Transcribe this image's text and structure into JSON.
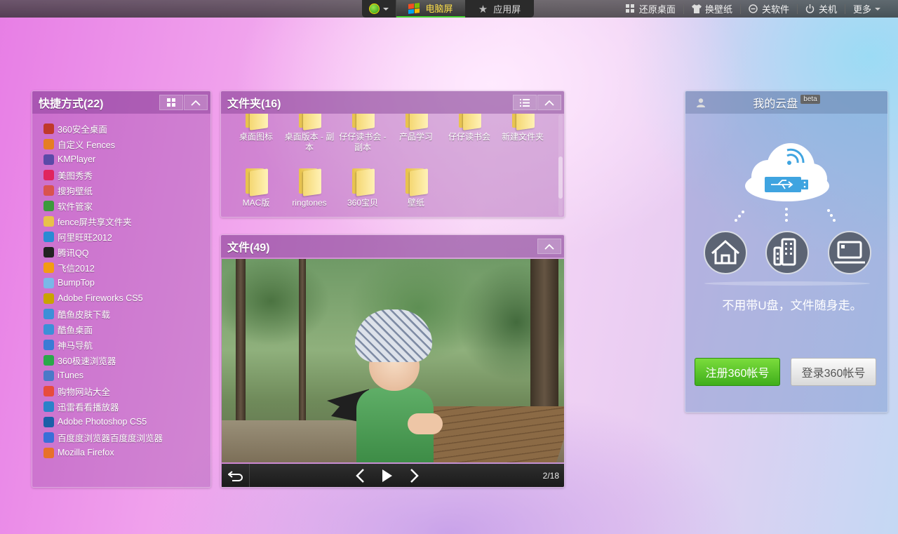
{
  "topbar": {
    "tabs": [
      {
        "label": "电脑屏",
        "active": true
      },
      {
        "label": "应用屏",
        "active": false
      }
    ],
    "actions": [
      {
        "label": "还原桌面",
        "icon": "grid-icon"
      },
      {
        "label": "换壁纸",
        "icon": "shirt-icon"
      },
      {
        "label": "关软件",
        "icon": "minus-circle-icon"
      },
      {
        "label": "关机",
        "icon": "power-icon"
      },
      {
        "label": "更多",
        "icon": "chevron-down-icon"
      }
    ]
  },
  "shortcuts": {
    "title": "快捷方式(22)",
    "items": [
      {
        "label": "360安全桌面",
        "color": "#c0392b"
      },
      {
        "label": "自定义 Fences",
        "color": "#e67e22"
      },
      {
        "label": "KMPlayer",
        "color": "#5b4aa8"
      },
      {
        "label": "美图秀秀",
        "color": "#e0245e"
      },
      {
        "label": "搜狗壁纸",
        "color": "#d9534f"
      },
      {
        "label": "软件管家",
        "color": "#3c9a3c"
      },
      {
        "label": "fence屏共享文件夹",
        "color": "#e8c24a"
      },
      {
        "label": "阿里旺旺2012",
        "color": "#2a8bd4"
      },
      {
        "label": "腾讯QQ",
        "color": "#222222"
      },
      {
        "label": "飞信2012",
        "color": "#f39c12"
      },
      {
        "label": "BumpTop",
        "color": "#7ab8e8"
      },
      {
        "label": "Adobe Fireworks CS5",
        "color": "#c9a400"
      },
      {
        "label": "酷鱼皮肤下载",
        "color": "#3c8fd8"
      },
      {
        "label": "酷鱼桌面",
        "color": "#3c8fd8"
      },
      {
        "label": "神马导航",
        "color": "#3a7bd5"
      },
      {
        "label": "360极速浏览器",
        "color": "#2aa84a"
      },
      {
        "label": "iTunes",
        "color": "#4a79c8"
      },
      {
        "label": "购物网站大全",
        "color": "#e74c3c"
      },
      {
        "label": "迅雷看看播放器",
        "color": "#2b82c9"
      },
      {
        "label": "Adobe Photoshop CS5",
        "color": "#1b5fa8"
      },
      {
        "label": "百度度浏览器百度度浏览器",
        "color": "#3a6fd8"
      },
      {
        "label": "Mozilla Firefox",
        "color": "#e8712a"
      }
    ]
  },
  "folders": {
    "title": "文件夹(16)",
    "items": [
      {
        "label": "桌面图标"
      },
      {
        "label": "桌面版本 - 副本"
      },
      {
        "label": "仔仔读书会 - 副本"
      },
      {
        "label": "产品学习"
      },
      {
        "label": "仔仔读书会"
      },
      {
        "label": "新建文件夹"
      },
      {
        "label": "MAC版"
      },
      {
        "label": "ringtones"
      },
      {
        "label": "360宝贝"
      },
      {
        "label": "壁纸"
      }
    ]
  },
  "files": {
    "title": "文件(49)",
    "counter": "2/18"
  },
  "cloud": {
    "title": "我的云盘",
    "badge": "beta",
    "slogan": "不用带U盘，文件随身走。",
    "register_label": "注册360帐号",
    "login_label": "登录360帐号"
  }
}
